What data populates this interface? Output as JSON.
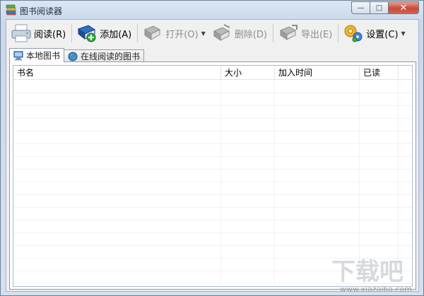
{
  "window": {
    "title": "图书阅读器",
    "controls": {
      "minimize": "—",
      "maximize": "□",
      "close": "✕"
    }
  },
  "toolbar": {
    "items": [
      {
        "label": "阅读(R)",
        "icon": "printer-icon",
        "enabled": true
      },
      {
        "label": "添加(A)",
        "icon": "add-book-icon",
        "enabled": true
      },
      {
        "label": "打开(O)",
        "icon": "open-book-icon",
        "enabled": false,
        "dropdown": true
      },
      {
        "label": "删除(D)",
        "icon": "delete-book-icon",
        "enabled": false
      },
      {
        "label": "导出(E)",
        "icon": "export-book-icon",
        "enabled": false
      },
      {
        "label": "设置(C)",
        "icon": "settings-gears-icon",
        "enabled": true,
        "dropdown": true
      }
    ]
  },
  "tabs": [
    {
      "label": "本地图书",
      "icon": "computer-icon",
      "active": true
    },
    {
      "label": "在线阅读的图书",
      "icon": "globe-icon",
      "active": false
    }
  ],
  "books_table": {
    "columns": [
      "书名",
      "大小",
      "加入时间",
      "已读"
    ],
    "rows": []
  },
  "watermark": {
    "text": "www.xiazaiba.com"
  },
  "colors": {
    "window_frame": "#c9d9ec",
    "close_button": "#c8493a",
    "disabled_text": "#8d8d8d"
  }
}
